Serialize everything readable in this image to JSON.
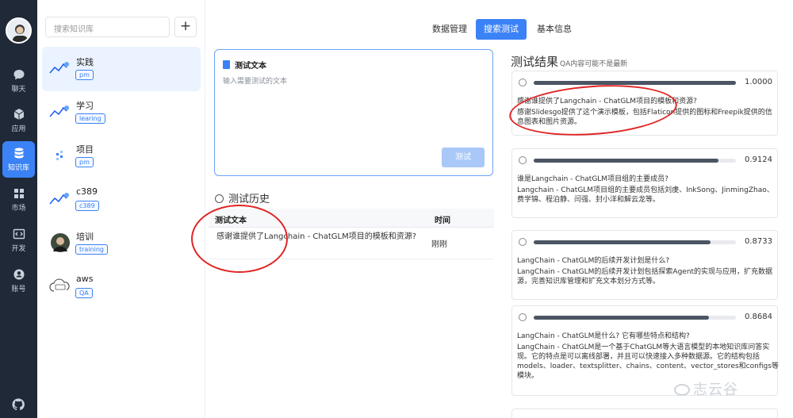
{
  "nav": {
    "items": [
      {
        "label": "聊天",
        "icon": "chat-icon"
      },
      {
        "label": "应用",
        "icon": "cube-icon"
      },
      {
        "label": "知识库",
        "icon": "database-icon"
      },
      {
        "label": "市场",
        "icon": "grid-icon"
      },
      {
        "label": "开发",
        "icon": "code-icon"
      },
      {
        "label": "账号",
        "icon": "user-icon"
      }
    ],
    "active": "知识库",
    "bottom_icon": "github-icon"
  },
  "kb": {
    "search_placeholder": "搜索知识库",
    "add_label": "+",
    "items": [
      {
        "title": "实践",
        "tag": "pm"
      },
      {
        "title": "学习",
        "tag": "learing"
      },
      {
        "title": "项目",
        "tag": "pm"
      },
      {
        "title": "c389",
        "tag": "c389"
      },
      {
        "title": "培训",
        "tag": "training"
      },
      {
        "title": "aws",
        "tag": "QA"
      }
    ]
  },
  "tabs": [
    {
      "label": "数据管理"
    },
    {
      "label": "搜索测试"
    },
    {
      "label": "基本信息"
    }
  ],
  "test": {
    "header": "测试文本",
    "placeholder": "输入需要测试的文本",
    "button": "测试"
  },
  "history": {
    "title": "测试历史",
    "col_text": "测试文本",
    "col_time": "时间",
    "rows": [
      {
        "text": "感谢谁提供了Langchain - ChatGLM项目的模板和资源?",
        "time": "刚刚"
      }
    ]
  },
  "results": {
    "title": "测试结果",
    "subtitle": "QA内容可能不是最新",
    "cards": [
      {
        "score": "1.0000",
        "score_value": 1.0,
        "q": "感谢谁提供了Langchain - ChatGLM项目的模板和资源?",
        "a": "感谢Slidesgo提供了这个演示模板，包括Flaticon提供的图标和Freepik提供的信息图表和图片资源。"
      },
      {
        "score": "0.9124",
        "score_value": 0.9124,
        "q": "谁是Langchain - ChatGLM项目组的主要成员?",
        "a": "Langchain - ChatGLM项目组的主要成员包括刘虔、InkSong、JinmingZhao、费学锦、程泊静、闫强、封小洋和解云龙等。"
      },
      {
        "score": "0.8733",
        "score_value": 0.8733,
        "q": "LangChain - ChatGLM的后续开发计划是什么?",
        "a": "LangChain - ChatGLM的后续开发计划包括探索Agent的实现与应用，扩充数据源，完善知识库管理和扩充文本划分方式等。"
      },
      {
        "score": "0.8684",
        "score_value": 0.8684,
        "q": "LangChain - ChatGLM是什么? 它有哪些特点和结构?",
        "a": "LangChain - ChatGLM是一个基于ChatGLM等大语言模型的本地知识库问答实现。它的特点是可以离线部署，并且可以快速接入多种数据源。它的结构包括models、loader、textsplitter、chains、content、vector_stores和configs等模块。"
      }
    ]
  },
  "watermark": "志云谷"
}
